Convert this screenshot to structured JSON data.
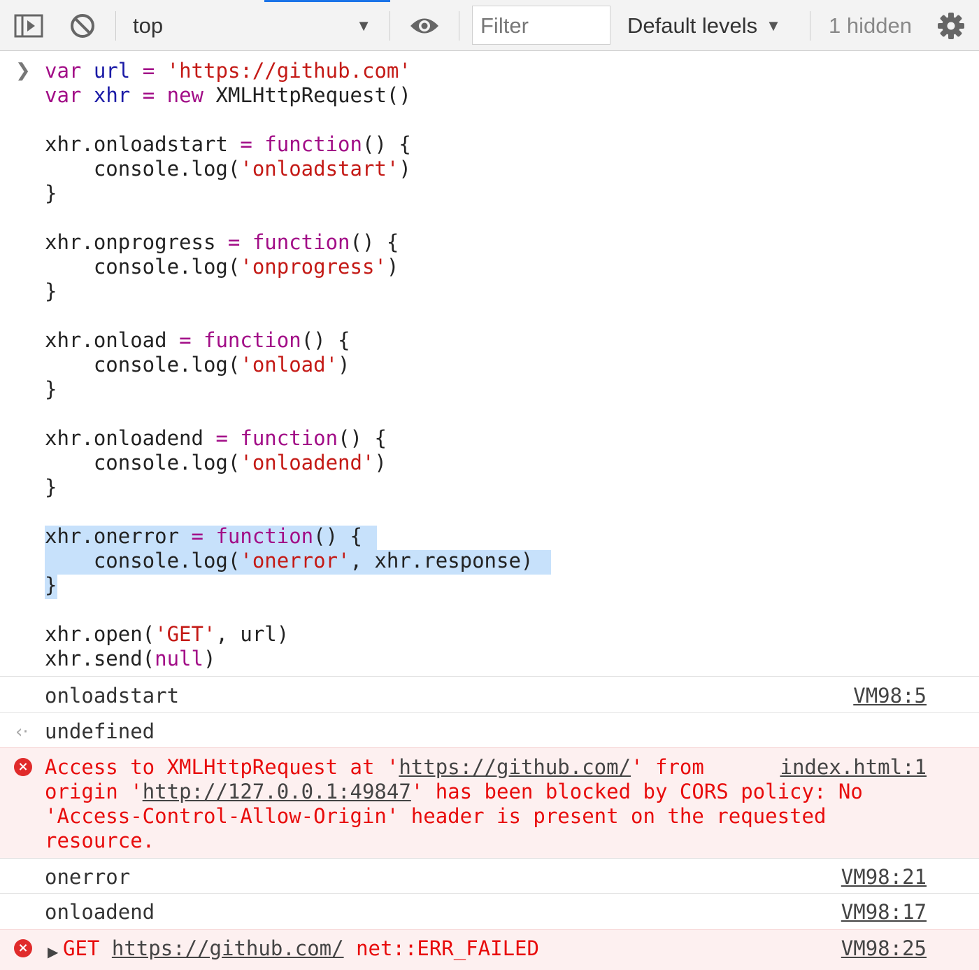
{
  "toolbar": {
    "context": "top",
    "filter_placeholder": "Filter",
    "levels": "Default levels",
    "hidden": "1 hidden",
    "icons": [
      "sidebar-toggle-icon",
      "clear-console-icon",
      "eye-icon",
      "gear-icon"
    ]
  },
  "code": {
    "l1_kw": "var",
    "l1_var": "url",
    "l1_op": " = ",
    "l1_str": "'https://github.com'",
    "l2_kw": "var",
    "l2_var": "xhr",
    "l2_op": " = ",
    "l2_new": "new",
    "l2_rest": " XMLHttpRequest()",
    "b1_lhs": "xhr.onloadstart",
    "b1_str": "'onloadstart'",
    "b2_lhs": "xhr.onprogress",
    "b2_str": "'onprogress'",
    "b3_lhs": "xhr.onload",
    "b3_str": "'onload'",
    "b4_lhs": "xhr.onloadend",
    "b4_str": "'onloadend'",
    "b5_lhs": "xhr.onerror",
    "b5_str": "'onerror'",
    "b5_extra": ", xhr.response)",
    "eq": " = ",
    "fn": "function",
    "fn_tail": "() {",
    "log_open": "    console.log(",
    "log_close": ")",
    "close_brace": "}",
    "open_pre": "xhr.open(",
    "open_str": "'GET'",
    "open_post": ", url)",
    "send_pre": "xhr.send(",
    "send_null": "null",
    "send_post": ")"
  },
  "messages": {
    "m1_text": "onloadstart",
    "m1_src": "VM98:5",
    "m2_text": "undefined",
    "err1_a": "Access to XMLHttpRequest at '",
    "err1_url": "https://github.com/",
    "err1_b": "' from",
    "err1_c": "origin '",
    "err1_origin": "http://127.0.0.1:49847",
    "err1_d": "' has been blocked by CORS policy: No",
    "err1_e": "'Access-Control-Allow-Origin' header is present on the requested",
    "err1_f": "resource.",
    "err1_src": "index.html:1",
    "m3_text": "onerror",
    "m3_src": "VM98:21",
    "m4_text": "onloadend",
    "m4_src": "VM98:17",
    "err2_method": "GET",
    "err2_url": "https://github.com/",
    "err2_code": "net::ERR_FAILED",
    "err2_src": "VM98:25"
  }
}
